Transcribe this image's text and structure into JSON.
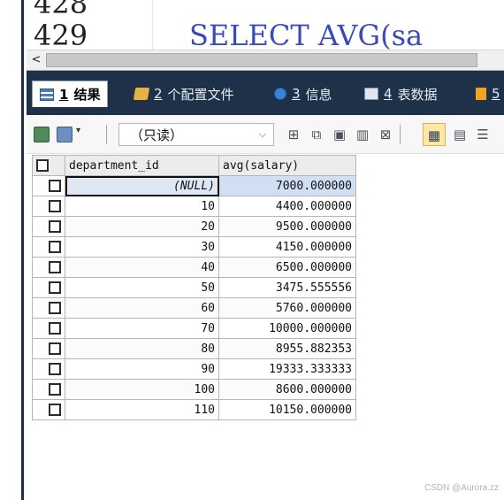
{
  "editor": {
    "line_a": "428",
    "line_b": "429",
    "code_partial": "SELECT  AVG(sa"
  },
  "scrollbar": {
    "left_arrow": "<"
  },
  "tabs": [
    {
      "num": "1",
      "label": "结果",
      "icon": "grid-icon",
      "active": true
    },
    {
      "num": "2",
      "label": "个配置文件",
      "icon": "config-icon",
      "active": false
    },
    {
      "num": "3",
      "label": "信息",
      "icon": "info-icon",
      "active": false
    },
    {
      "num": "4",
      "label": "表数据",
      "icon": "table-icon",
      "active": false
    },
    {
      "num": "5",
      "label": "",
      "icon": "more-icon",
      "active": false
    }
  ],
  "toolbar": {
    "readonly_label": "（只读）",
    "dropdown_caret": "▾"
  },
  "grid": {
    "columns": [
      "department_id",
      "avg(salary)"
    ],
    "rows": [
      {
        "department_id": "(NULL)",
        "avg_salary": "7000.000000"
      },
      {
        "department_id": "10",
        "avg_salary": "4400.000000"
      },
      {
        "department_id": "20",
        "avg_salary": "9500.000000"
      },
      {
        "department_id": "30",
        "avg_salary": "4150.000000"
      },
      {
        "department_id": "40",
        "avg_salary": "6500.000000"
      },
      {
        "department_id": "50",
        "avg_salary": "3475.555556"
      },
      {
        "department_id": "60",
        "avg_salary": "5760.000000"
      },
      {
        "department_id": "70",
        "avg_salary": "10000.000000"
      },
      {
        "department_id": "80",
        "avg_salary": "8955.882353"
      },
      {
        "department_id": "90",
        "avg_salary": "19333.333333"
      },
      {
        "department_id": "100",
        "avg_salary": "8600.000000"
      },
      {
        "department_id": "110",
        "avg_salary": "10150.000000"
      }
    ]
  },
  "watermark": "CSDN @Aurora.zz"
}
